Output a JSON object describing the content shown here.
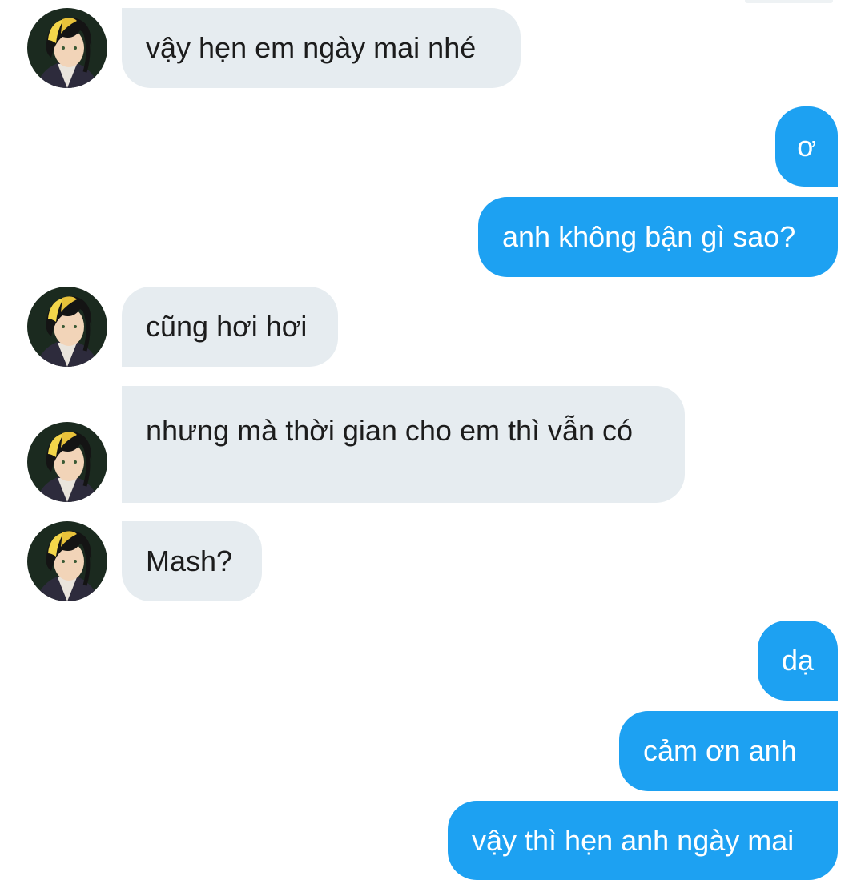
{
  "conversation": {
    "messages": [
      {
        "side": "in",
        "avatar": "avatar-anime-man-icon",
        "text": "vậy hẹn em ngày mai nhé"
      },
      {
        "side": "out",
        "text": "ơ"
      },
      {
        "side": "out",
        "text": "anh không bận gì sao?"
      },
      {
        "side": "in",
        "avatar": "avatar-anime-man-icon",
        "text": "cũng hơi hơi"
      },
      {
        "side": "in",
        "avatar": "avatar-anime-man-icon",
        "text": "nhưng mà thời gian cho em thì vẫn có"
      },
      {
        "side": "in",
        "avatar": "avatar-anime-man-icon",
        "text": "Mash?"
      },
      {
        "side": "out",
        "text": "dạ"
      },
      {
        "side": "out",
        "text": "cảm ơn anh"
      },
      {
        "side": "out",
        "text": "vậy thì hẹn anh ngày mai"
      }
    ]
  },
  "colors": {
    "incoming_bubble": "#e6ecf0",
    "outgoing_bubble": "#1da1f2",
    "incoming_text": "#1c1c1c",
    "outgoing_text": "#ffffff"
  }
}
